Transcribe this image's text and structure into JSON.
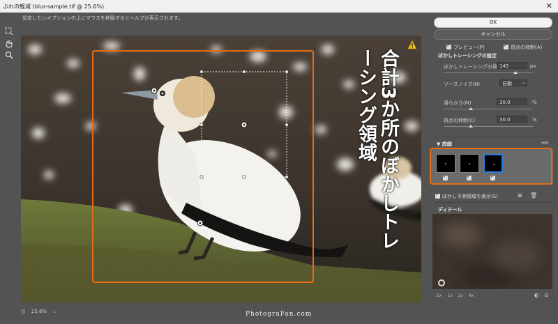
{
  "window": {
    "title": "ぶれの軽減 (blur-sample.tif @ 25.6%)",
    "close_glyph": "✕"
  },
  "hint_text": "設定したいオプションの上にマウスを移動するとヘルプが表示されます。",
  "annotation": {
    "text": "合計3か所のぼかしトレーシング領域"
  },
  "zoom": {
    "level": "25.6%"
  },
  "watermark": "PhotograFan.com",
  "buttons": {
    "ok": "OK",
    "cancel": "キャンセル"
  },
  "options": {
    "preview": "プレビュー(P)",
    "artifact_suppression": "斑点の抑制(A)"
  },
  "blur_trace": {
    "section_title": "ぼかしトレーシングの設定",
    "bounds_label": "ぼかしトレーシングの境界(B)",
    "bounds_value": "145",
    "bounds_unit": "px",
    "source_noise_label": "ソースノイズ(N)",
    "source_noise_value": "自動",
    "smoothing_label": "滑らかさ(M)",
    "smoothing_value": "30.0",
    "smoothing_unit": "%",
    "artifact_label": "斑点の抑制(C)",
    "artifact_value": "30.0",
    "artifact_unit": "%"
  },
  "advanced": {
    "title": "▼ 詳細",
    "show_estimates": "ぼかし予測領域を表示(S)"
  },
  "detail": {
    "title": "ディテール",
    "zoom_options": [
      ".5x",
      "1x",
      "2x",
      "4x"
    ]
  },
  "colors": {
    "highlight": "#e36c14",
    "selected_thumb": "#2a7ae2"
  }
}
